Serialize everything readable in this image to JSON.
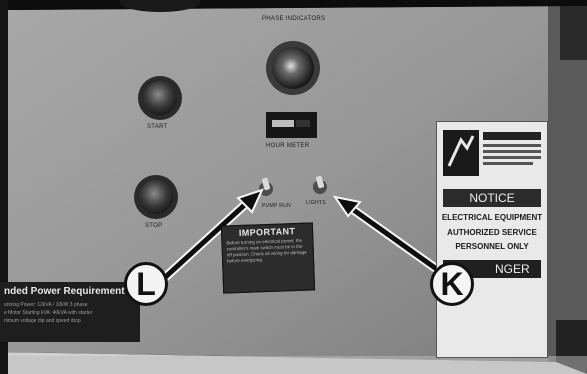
{
  "panel": {
    "phase_indicators_label": "PHASE INDICATORS",
    "start_label": "START",
    "stop_label": "STOP",
    "hour_meter_label": "HOUR METER",
    "pump_switch_label": "PUMP RUN",
    "lights_switch_label": "LIGHTS"
  },
  "important_sign": {
    "title": "IMPORTANT",
    "body": "Before turning on electrical power, the controller's main switch must be in the off position. Check all wiring for damage before energizing."
  },
  "notice_label": {
    "header": "NOTICE",
    "line1": "ELECTRICAL EQUIPMENT",
    "line2": "AUTHORIZED SERVICE",
    "line3": "PERSONNEL ONLY",
    "danger_partial": "NGER"
  },
  "power_plate": {
    "title": "nded Power Requirement",
    "line1": "unning Power: 12kVA / 10kW 3 phase",
    "line2": "e Motor Starting kVA: 40kVA with starter",
    "line3": "nimum voltage dip and speed drop"
  },
  "callouts": {
    "left": "L",
    "right": "K"
  },
  "colors": {
    "panel_face": "#9c9c9c",
    "frame": "#101010",
    "callout_fill": "#f4f4f4"
  }
}
